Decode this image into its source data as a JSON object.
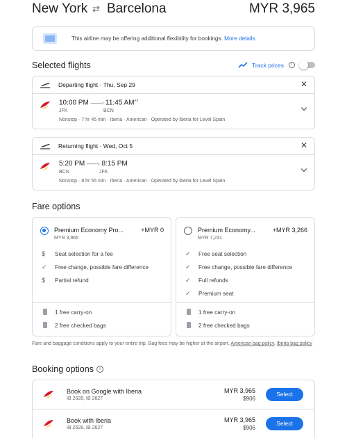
{
  "header": {
    "origin": "New York",
    "destination": "Barcelona",
    "price": "MYR 3,965"
  },
  "notice": {
    "text": "This airline may be offering additional flexibility for bookings.",
    "link": "More details"
  },
  "selected": {
    "title": "Selected flights",
    "track_label": "Track prices"
  },
  "departing": {
    "label": "Departing flight · Thu, Sep 29",
    "dep_time": "10:00 PM",
    "arr_time": "11:45 AM",
    "day_offset": "+1",
    "from": "JFK",
    "to": "BCN",
    "details": [
      "Nonstop",
      "7 hr 45 min",
      "Iberia · American · Operated by Iberia for Level Spain"
    ]
  },
  "returning": {
    "label": "Returning flight · Wed, Oct 5",
    "dep_time": "5:20 PM",
    "arr_time": "8:15 PM",
    "from": "BCN",
    "to": "JFK",
    "details": [
      "Nonstop",
      "8 hr 55 min",
      "Iberia · American · Operated by Iberia for Level Spain"
    ]
  },
  "fare": {
    "title": "Fare options",
    "options": [
      {
        "name": "Premium Economy Pro...",
        "delta": "+MYR 0",
        "total": "MYR 3,965",
        "features": [
          "Seat selection for a fee",
          "Free change, possible fare difference",
          "Partial refund"
        ],
        "bags": [
          "1 free carry-on",
          "2 free checked bags"
        ]
      },
      {
        "name": "Premium Economy...",
        "delta": "+MYR 3,266",
        "total": "MYR 7,231",
        "features": [
          "Free seat selection",
          "Free change, possible fare difference",
          "Full refunds",
          "Premium seat"
        ],
        "bags": [
          "1 free carry-on",
          "2 free checked bags"
        ]
      }
    ],
    "disclaimer": "Fare and baggage conditions apply to your entire trip. Bag fees may be higher at the airport.",
    "policy_links": [
      "American bag policy",
      "Iberia bag policy"
    ]
  },
  "booking": {
    "title": "Booking options",
    "items": [
      {
        "name": "Book on Google with Iberia",
        "flights": "IB 2628, IB 2627",
        "price": "MYR 3,965",
        "sub_price": "$906",
        "button": "Select"
      },
      {
        "name": "Book with Iberia",
        "flights": "IB 2628, IB 2627",
        "price": "MYR 3,965",
        "sub_price": "$906",
        "button": "Select"
      }
    ]
  },
  "colors": {
    "accent": "#1a73e8",
    "iberia_red": "#d7192d",
    "iberia_yellow": "#fcb813"
  }
}
